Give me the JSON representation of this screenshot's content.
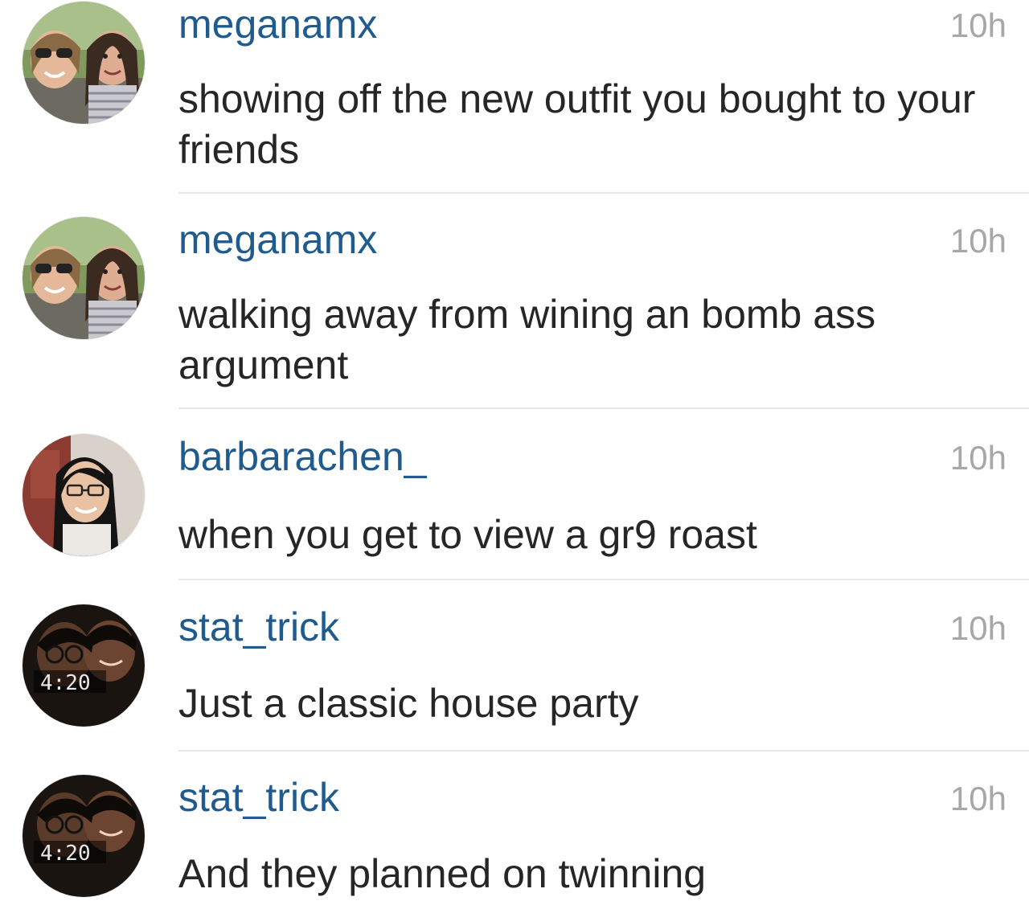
{
  "feed": {
    "items": [
      {
        "username": "meganamx",
        "time": "10h",
        "caption": "showing off the new outfit you bought to your friends",
        "avatar_icon": "friends-selfie-avatar"
      },
      {
        "username": "meganamx",
        "time": "10h",
        "caption": "walking away from wining an bomb ass argument",
        "avatar_icon": "friends-selfie-avatar"
      },
      {
        "username": "barbarachen_",
        "time": "10h",
        "caption": "when you get to view a gr9 roast",
        "avatar_icon": "portrait-avatar"
      },
      {
        "username": "stat_trick",
        "time": "10h",
        "caption": "Just a classic house party",
        "avatar_icon": "clock-selfie-avatar",
        "avatar_overlay": "4:20"
      },
      {
        "username": "stat_trick",
        "time": "10h",
        "caption": "And they planned on twinning",
        "avatar_icon": "clock-selfie-avatar",
        "avatar_overlay": "4:20"
      }
    ]
  },
  "colors": {
    "username": "#1f5b8e",
    "caption": "#262626",
    "time": "#a7a7a7",
    "divider": "#e8e8e8"
  }
}
